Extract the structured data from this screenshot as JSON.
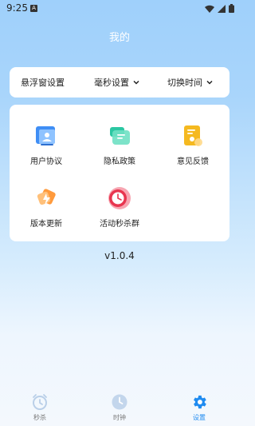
{
  "status_bar": {
    "time": "9:25",
    "app_badge": "A"
  },
  "header": {
    "title": "我的"
  },
  "settings": {
    "float_window": "悬浮窗设置",
    "ms_setting": "毫秒设置",
    "switch_time": "切换时间"
  },
  "menu": {
    "items": [
      {
        "label": "用户协议",
        "icon": "user-agreement-icon"
      },
      {
        "label": "隐私政策",
        "icon": "privacy-policy-icon"
      },
      {
        "label": "意见反馈",
        "icon": "feedback-icon"
      },
      {
        "label": "版本更新",
        "icon": "version-update-icon"
      },
      {
        "label": "活动秒杀群",
        "icon": "flash-sale-group-icon"
      }
    ]
  },
  "version": "v1.0.4",
  "tabbar": {
    "tabs": [
      {
        "label": "秒杀",
        "icon": "alarm-clock-icon",
        "active": false
      },
      {
        "label": "时钟",
        "icon": "clock-icon",
        "active": false
      },
      {
        "label": "设置",
        "icon": "gear-icon",
        "active": true
      }
    ]
  },
  "colors": {
    "accent": "#1f8bf0",
    "background_top": "#9fd0fb",
    "background_bottom": "#f4f8fd"
  }
}
